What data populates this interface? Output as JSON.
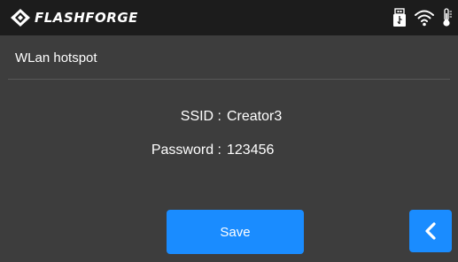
{
  "header": {
    "brand": "FLASHFORGE",
    "icons": [
      "flashforge-logo-icon",
      "usb-icon",
      "wifi-icon",
      "thermometer-icon"
    ]
  },
  "page": {
    "title": "WLan hotspot"
  },
  "hotspot": {
    "ssid_label": "SSID :",
    "ssid_value": "Creator3",
    "password_label": "Password :",
    "password_value": "123456"
  },
  "actions": {
    "save_label": "Save",
    "back_icon": "chevron-left-icon"
  },
  "colors": {
    "background": "#3d3d3d",
    "topbar": "#1c1c1c",
    "accent": "#1a8cff"
  }
}
